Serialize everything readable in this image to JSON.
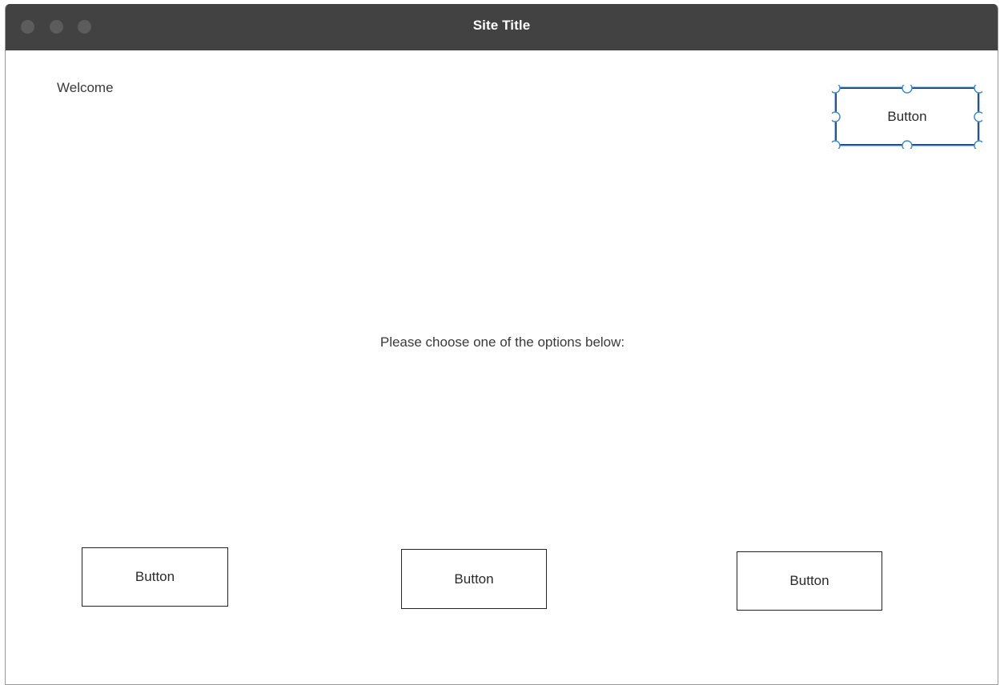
{
  "window": {
    "title": "Site Title"
  },
  "content": {
    "welcome_text": "Welcome",
    "prompt_text": "Please choose one of the options below:",
    "top_button_label": "Button",
    "option_buttons": [
      {
        "label": "Button"
      },
      {
        "label": "Button"
      },
      {
        "label": "Button"
      }
    ]
  },
  "colors": {
    "titlebar": "#424242",
    "selection_handles": "#3a8fd8",
    "selected_border": "#1f3a78"
  }
}
